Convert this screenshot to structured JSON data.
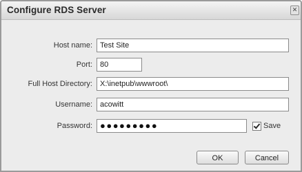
{
  "dialog": {
    "title": "Configure RDS Server",
    "close_glyph": "✕"
  },
  "form": {
    "host_name": {
      "label": "Host name:",
      "value": "Test Site"
    },
    "port": {
      "label": "Port:",
      "value": "80"
    },
    "full_host_directory": {
      "label": "Full Host Directory:",
      "value": "X:\\inetpub\\wwwroot\\"
    },
    "username": {
      "label": "Username:",
      "value": "acowitt"
    },
    "password": {
      "label": "Password:",
      "value": "●●●●●●●●●",
      "save_label": "Save",
      "save_checked": true
    }
  },
  "buttons": {
    "ok": "OK",
    "cancel": "Cancel"
  }
}
